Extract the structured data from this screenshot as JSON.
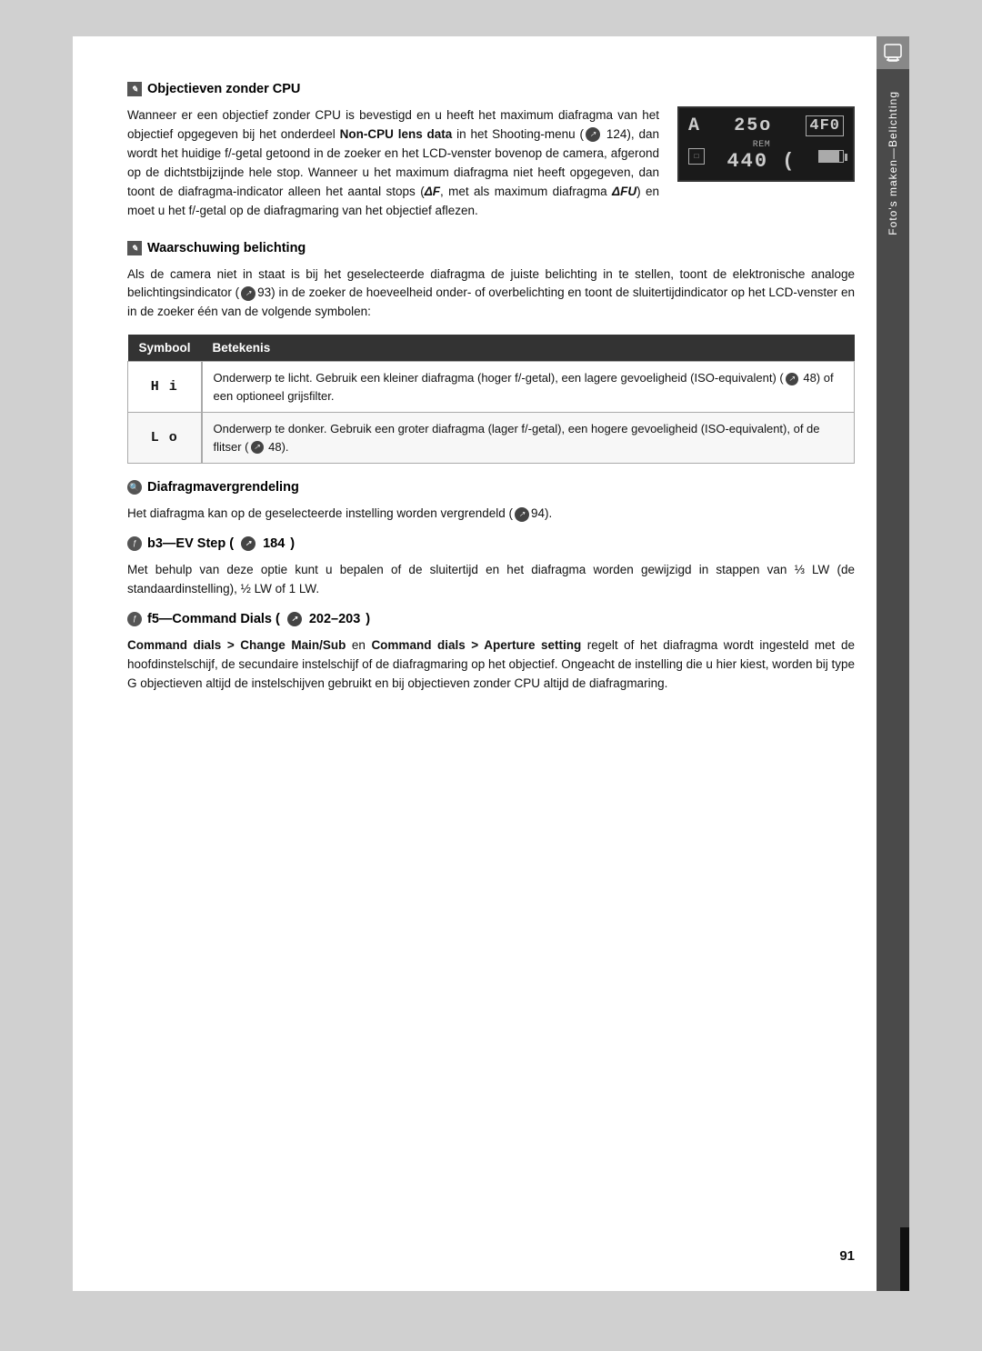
{
  "page": {
    "number": "91",
    "background": "#ffffff"
  },
  "sidebar": {
    "label": "Foto's maken—Belichting",
    "top_icon": "▣"
  },
  "sections": {
    "cpu_lens": {
      "icon": "✎",
      "title": "Objectieven zonder CPU",
      "para1": "Wanneer er een objectief zonder CPU is bevestigd en u heeft het maximum diafragma van het objectief opgegeven bij het onderdeel ",
      "bold1": "Non-CPU lens data",
      "para1b": " in het Shooting-menu (",
      "para1c": " 124), dan wordt het huidige f/-getal getoond in de zoeker en het LCD-venster bovenop de camera, afgerond op de dichtstbijzijnde hele stop. Wanneer u het maximum diafragma niet heeft opgegeven, dan toont de diafragma-indicator alleen het aantal stops (",
      "delta_f": "ΔF",
      "para1d": ", met als maximum diafragma ",
      "delta_fu": "ΔFU",
      "para1e": ") en moet u het f/-getal op de diafragmaring van het objectief aflezen."
    },
    "warning": {
      "icon": "✎",
      "title": "Waarschuwing belichting",
      "para": "Als de camera niet in staat is bij het geselecteerde diafragma de juiste belichting in te stellen, toont de elektronische analoge belichtingsindicator (",
      "page_ref": "93",
      "para_b": ") in de zoeker de hoeveelheid onder- of overbelichting en toont de sluitertijdindicator op het LCD-venster en in de zoeker één van de volgende symbolen:"
    },
    "table": {
      "col1_header": "Symbool",
      "col2_header": "Betekenis",
      "rows": [
        {
          "symbol": "H i",
          "meaning": "Onderwerp te licht. Gebruik een kleiner diafragma (hoger f/-getal), een lagere gevoeligheid (ISO-equivalent) ( 48) of een optioneel grijsfilter."
        },
        {
          "symbol": "L o",
          "meaning": "Onderwerp te donker. Gebruik een groter diafragma (lager f/-getal), een hogere gevoeligheid (ISO-equivalent), of de flitser ( 48)."
        }
      ]
    },
    "lock": {
      "icon": "🔍",
      "title": "Diafragmavergrendeling",
      "para": "Het diafragma kan op de geselecteerde instelling worden vergrendeld (",
      "page_ref": "94",
      "para_b": ")."
    },
    "b3": {
      "icon": "ƒ",
      "title": "b3—EV Step (",
      "page_ref": "184",
      "title_end": ")",
      "para": "Met behulp van deze optie kunt u bepalen of de sluitertijd en het diafragma worden gewijzigd in stappen van ⅓ LW (de standaardinstelling), ½ LW of 1 LW."
    },
    "f5": {
      "icon": "ƒ",
      "title": "f5—Command Dials (",
      "page_ref": "202–203",
      "title_end": ")",
      "para1_bold": "Command dials > Change Main/Sub",
      "para1_text": " en ",
      "para1_bold2": "Command dials > Aperture setting",
      "para1_text2": " regelt of het diafragma wordt ingesteld met de hoofdinstelschijf, de secundaire instelschijf of de diafragmaring op het objectief. Ongeacht de instelling die u hier kiest, worden bij type G objectieven altijd de instelschijven gebruikt en bij objectieven zonder CPU altijd de diafragmaring."
    }
  },
  "camera_display": {
    "top_left": "A",
    "top_center": "25o",
    "top_right": "4F0",
    "bottom_left_box": "□",
    "rem_label": "REM",
    "bottom_number": "440 (",
    "battery": "▓"
  }
}
